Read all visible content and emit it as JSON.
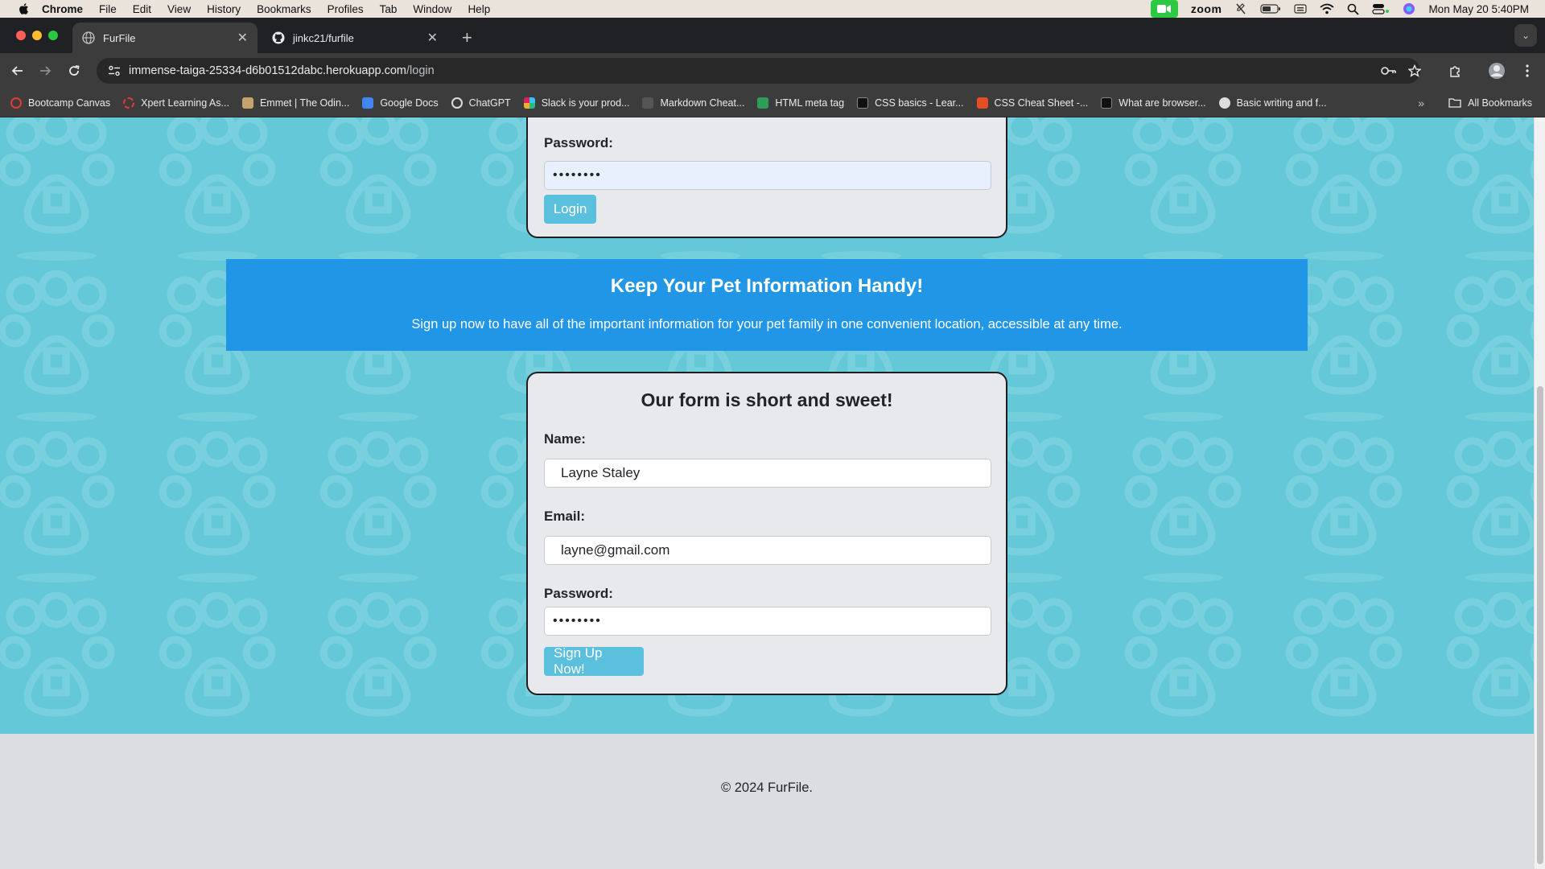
{
  "menubar": {
    "app": "Chrome",
    "items": [
      "File",
      "Edit",
      "View",
      "History",
      "Bookmarks",
      "Profiles",
      "Tab",
      "Window",
      "Help"
    ],
    "zoom_label": "zoom",
    "datetime": "Mon May 20  5:40PM"
  },
  "tabs": [
    {
      "title": "FurFile",
      "active": true
    },
    {
      "title": "jinkc21/furfile",
      "active": false
    }
  ],
  "toolbar": {
    "url_host": "immense-taiga-25334-d6b01512dabc.herokuapp.com",
    "url_path": "/login"
  },
  "bookmarks": {
    "items": [
      {
        "label": "Bootcamp Canvas",
        "color": "#e53935"
      },
      {
        "label": "Xpert Learning As...",
        "color": "#e53935"
      },
      {
        "label": "Emmet | The Odin...",
        "color": "#c8a26b"
      },
      {
        "label": "Google Docs",
        "color": "#4285f4"
      },
      {
        "label": "ChatGPT",
        "color": "#dddddd"
      },
      {
        "label": "Slack is your prod...",
        "color": "#e01e5a"
      },
      {
        "label": "Markdown Cheat...",
        "color": "#555555"
      },
      {
        "label": "HTML meta tag",
        "color": "#2e9e5b"
      },
      {
        "label": "CSS basics - Lear...",
        "color": "#111111"
      },
      {
        "label": "CSS Cheat Sheet -...",
        "color": "#e44d26"
      },
      {
        "label": "What are browser...",
        "color": "#111111"
      },
      {
        "label": "Basic writing and f...",
        "color": "#dddddd"
      }
    ],
    "all_label": "All Bookmarks"
  },
  "login": {
    "password_label": "Password:",
    "password_value": "••••••••",
    "button": "Login"
  },
  "banner": {
    "heading": "Keep Your Pet Information Handy!",
    "text": "Sign up now to have all of the important information for your pet family in one convenient location, accessible at any time."
  },
  "signup": {
    "title": "Our form is short and sweet!",
    "name_label": "Name:",
    "name_value": "Layne Staley",
    "email_label": "Email:",
    "email_value": "layne@gmail.com",
    "password_label": "Password:",
    "password_value": "••••••••",
    "button": "Sign Up Now!"
  },
  "footer": {
    "copyright": "© 2024 FurFile."
  },
  "colors": {
    "page_bg": "#64c8d8",
    "banner": "#2196e6",
    "button": "#5bc0de",
    "footer": "#dcdde1"
  }
}
